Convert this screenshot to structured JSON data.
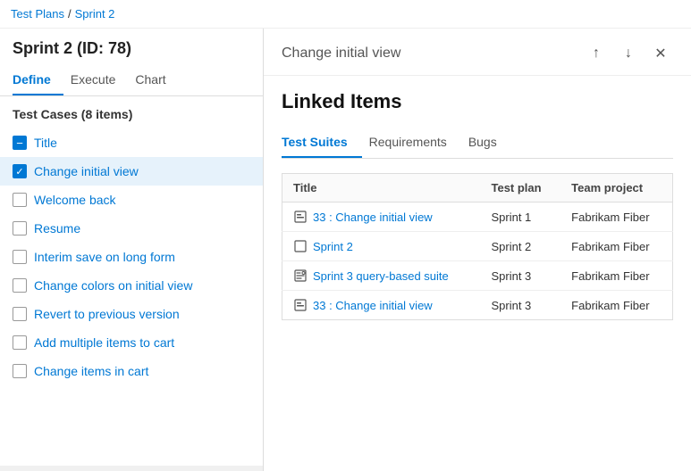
{
  "breadcrumb": {
    "part1": "Test Plans",
    "separator": "/",
    "part2": "Sprint 2"
  },
  "left": {
    "title": "Sprint 2 (ID: 78)",
    "tabs": [
      {
        "label": "Define",
        "active": true
      },
      {
        "label": "Execute",
        "active": false
      },
      {
        "label": "Chart",
        "active": false
      }
    ],
    "testCasesHeader": "Test Cases (8 items)",
    "items": [
      {
        "label": "Title",
        "checkState": "minus",
        "selected": false
      },
      {
        "label": "Change initial view",
        "checkState": "checked",
        "selected": true
      },
      {
        "label": "Welcome back",
        "checkState": "unchecked",
        "selected": false
      },
      {
        "label": "Resume",
        "checkState": "unchecked",
        "selected": false
      },
      {
        "label": "Interim save on long form",
        "checkState": "unchecked",
        "selected": false
      },
      {
        "label": "Change colors on initial view",
        "checkState": "unchecked",
        "selected": false
      },
      {
        "label": "Revert to previous version",
        "checkState": "unchecked",
        "selected": false
      },
      {
        "label": "Add multiple items to cart",
        "checkState": "unchecked",
        "selected": false
      },
      {
        "label": "Change items in cart",
        "checkState": "unchecked",
        "selected": false
      }
    ]
  },
  "right": {
    "panelTitle": "Change initial view",
    "linkedItemsTitle": "Linked Items",
    "subTabs": [
      {
        "label": "Test Suites",
        "active": true
      },
      {
        "label": "Requirements",
        "active": false
      },
      {
        "label": "Bugs",
        "active": false
      }
    ],
    "table": {
      "columns": [
        "Title",
        "Test plan",
        "Team project"
      ],
      "rows": [
        {
          "icon": "suite",
          "title": "33 : Change initial view",
          "testPlan": "Sprint 1",
          "teamProject": "Fabrikam Fiber"
        },
        {
          "icon": "suite-plain",
          "title": "Sprint 2",
          "testPlan": "Sprint 2",
          "teamProject": "Fabrikam Fiber"
        },
        {
          "icon": "suite-query",
          "title": "Sprint 3 query-based suite",
          "testPlan": "Sprint 3",
          "teamProject": "Fabrikam Fiber"
        },
        {
          "icon": "suite",
          "title": "33 : Change initial view",
          "testPlan": "Sprint 3",
          "teamProject": "Fabrikam Fiber"
        }
      ]
    },
    "icons": {
      "up": "↑",
      "down": "↓",
      "close": "✕"
    }
  }
}
